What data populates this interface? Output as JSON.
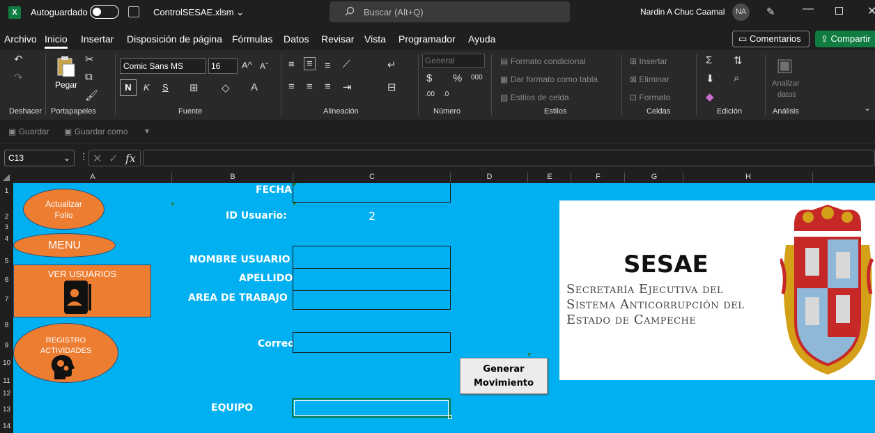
{
  "titlebar": {
    "app_icon": "X",
    "autosave_label": "Autoguardado",
    "filename": "ControlSESAE.xlsm",
    "search_placeholder": "Buscar (Alt+Q)",
    "user_name": "Nardin A Chuc Caamal",
    "user_initials": "NA"
  },
  "menu": {
    "tabs": [
      "Archivo",
      "Inicio",
      "Insertar",
      "Disposición de página",
      "Fórmulas",
      "Datos",
      "Revisar",
      "Vista",
      "Programador",
      "Ayuda"
    ],
    "active_tab": "Inicio",
    "comments_label": "Comentarios",
    "share_label": "Compartir"
  },
  "ribbon": {
    "groups": [
      "Deshacer",
      "Portapapeles",
      "Fuente",
      "Alineación",
      "Número",
      "Estilos",
      "Celdas",
      "Edición",
      "Análisis"
    ],
    "paste_label": "Pegar",
    "font_name": "Comic Sans MS",
    "font_size": "16",
    "bold_label": "N",
    "italic_label": "K",
    "underline_label": "S",
    "number_format": "General",
    "styles": [
      "Formato condicional",
      "Dar formato como tabla",
      "Estilos de celda"
    ],
    "cells": [
      "Insertar",
      "Eliminar",
      "Formato"
    ],
    "analyze": [
      "Analizar",
      "datos"
    ]
  },
  "quickbar": {
    "save_label": "Guardar",
    "save_as_label": "Guardar como"
  },
  "formula_bar": {
    "cell_ref": "C13",
    "formula": "",
    "fx_label": "fx"
  },
  "columns": [
    "A",
    "B",
    "C",
    "D",
    "E",
    "F",
    "G",
    "H"
  ],
  "rows": [
    "1",
    "2",
    "3",
    "4",
    "5",
    "6",
    "7",
    "8",
    "9",
    "10",
    "11",
    "12",
    "13",
    "14"
  ],
  "sheet": {
    "buttons": {
      "actualizar_folio": [
        "Actualizar",
        "Folio"
      ],
      "menu": "MENU",
      "ver_usuarios": "VER USUARIOS",
      "registro": [
        "REGISTRO",
        "ACTIVIDADES"
      ],
      "generar": [
        "Generar",
        "Movimiento"
      ]
    },
    "labels": {
      "fecha": "FECHA",
      "id_usuario": "ID Usuario:",
      "id_value": "2",
      "nombre": "NOMBRE USUARIO",
      "apellido": "APELLIDO",
      "area": "AREA DE TRABAJO",
      "correo": "Correo",
      "equipo": "EQUIPO"
    },
    "logo": {
      "title": "SESAE",
      "lines": [
        "Secretaría Ejecutiva del",
        "Sistema Anticorrupción del",
        "Estado de Campeche"
      ]
    }
  },
  "colors": {
    "sheet_bg": "#00b0f0",
    "button_orange": "#ed7d31",
    "excel_green": "#107c41"
  }
}
